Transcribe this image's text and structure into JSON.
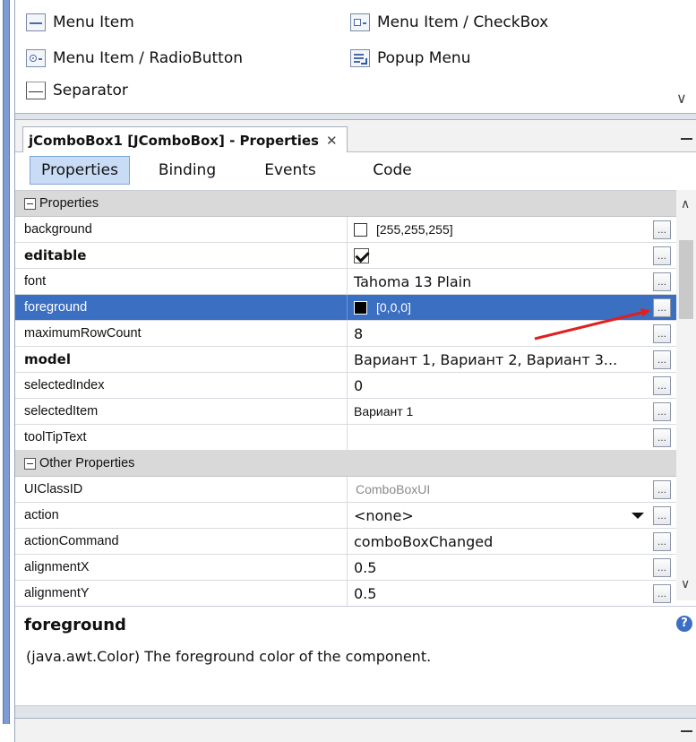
{
  "palette": {
    "items": [
      {
        "label": "Menu Item",
        "icon": "menu-item-icon"
      },
      {
        "label": "Menu Item / CheckBox",
        "icon": "menu-item-checkbox-icon"
      },
      {
        "label": "Menu Item / RadioButton",
        "icon": "menu-item-radiobutton-icon"
      },
      {
        "label": "Popup Menu",
        "icon": "popup-menu-icon"
      },
      {
        "label": "Separator",
        "icon": "separator-icon"
      }
    ]
  },
  "window": {
    "tab_title": "jComboBox1 [JComboBox] - Properties",
    "close_glyph": "✕"
  },
  "subtabs": [
    {
      "label": "Properties",
      "active": true
    },
    {
      "label": "Binding",
      "active": false
    },
    {
      "label": "Events",
      "active": false
    },
    {
      "label": "Code",
      "active": false
    }
  ],
  "properties": {
    "section_label": "Properties",
    "rows": [
      {
        "name": "background",
        "value": "[255,255,255]",
        "swatch": "#ffffff"
      },
      {
        "name": "editable",
        "checked": true
      },
      {
        "name": "font",
        "value": "Tahoma 13 Plain"
      },
      {
        "name": "foreground",
        "value": "[0,0,0]",
        "swatch": "#000000",
        "selected": true
      },
      {
        "name": "maximumRowCount",
        "value": "8"
      },
      {
        "name": "model",
        "value": "Вариант 1, Вариант 2, Вариант 3..."
      },
      {
        "name": "selectedIndex",
        "value": "0"
      },
      {
        "name": "selectedItem",
        "value": "Вариант 1"
      },
      {
        "name": "toolTipText",
        "value": ""
      }
    ]
  },
  "other_properties": {
    "section_label": "Other Properties",
    "rows": [
      {
        "name": "UIClassID",
        "value": "ComboBoxUI"
      },
      {
        "name": "action",
        "value": "<none>"
      },
      {
        "name": "actionCommand",
        "value": "comboBoxChanged"
      },
      {
        "name": "alignmentX",
        "value": "0.5"
      },
      {
        "name": "alignmentY",
        "value": "0.5"
      }
    ]
  },
  "description": {
    "title": "foreground",
    "text": "(java.awt.Color) The foreground color of the component.",
    "help_glyph": "?"
  },
  "colors": {
    "selection": "#3a6fc2",
    "annotation_arrow": "#e0201e",
    "active_tab": "#c9dcf5"
  }
}
